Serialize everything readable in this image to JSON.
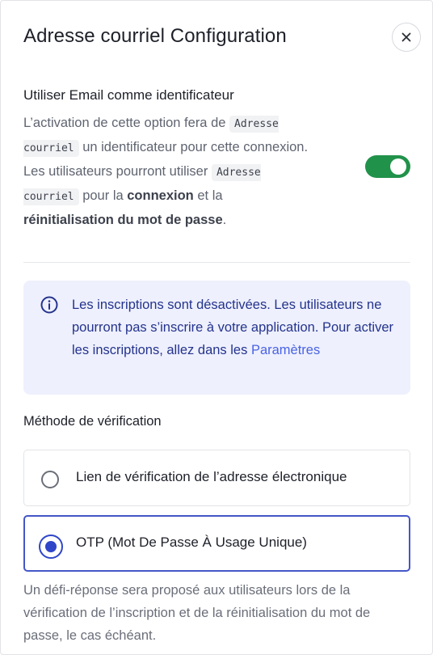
{
  "dialog": {
    "title": "Adresse courriel Configuration",
    "close_icon": "close-icon"
  },
  "identifier_setting": {
    "title": "Utiliser Email comme identificateur",
    "desc_part1": "L’activation de cette option fera de ",
    "code1": "Adresse courriel",
    "desc_part2": " un identificateur pour cette connexion. Les utilisateurs pourront utiliser ",
    "code2": "Adresse courriel",
    "desc_part3": " pour la ",
    "bold1": "connexion",
    "desc_part4": " et la ",
    "bold2": "réinitialisation du mot de passe",
    "desc_part5": ".",
    "toggle_on": true,
    "toggle_color": "#21924a"
  },
  "info": {
    "icon": "info-icon",
    "text": "Les inscriptions sont désactivées. Les utilisateurs ne pourront pas s’inscrire à votre application. Pour activer les inscriptions, allez dans les ",
    "link": "Paramètres"
  },
  "verification": {
    "label": "Méthode de vérification",
    "options": [
      {
        "label": "Lien de vérification de l’adresse électronique",
        "selected": false
      },
      {
        "label": "OTP (Mot De Passe À Usage Unique)",
        "selected": true
      }
    ],
    "footnote": "Un défi-réponse sera proposé aux utilisateurs lors de la vérification de l’inscription et de la réinitialisation du mot de passe, le cas échéant."
  },
  "colors": {
    "accent": "#2f46c9",
    "info_bg": "#eef0fd",
    "info_text": "#24338d",
    "link": "#4a63e3"
  }
}
